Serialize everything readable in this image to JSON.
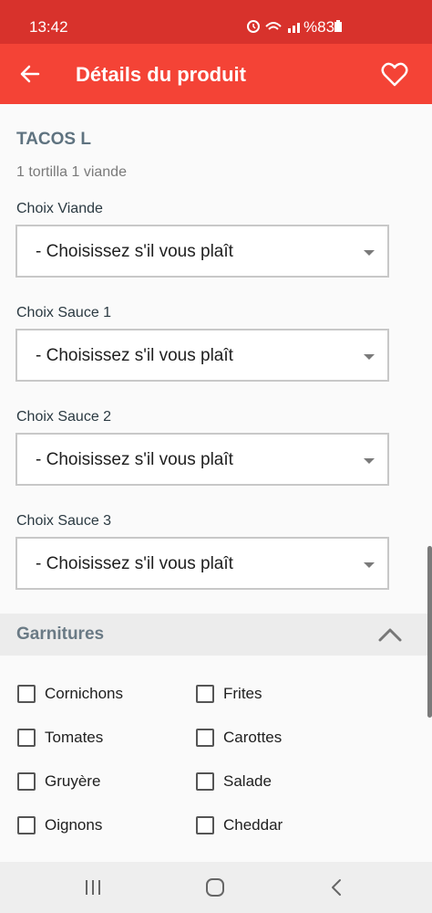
{
  "status": {
    "time": "13:42",
    "battery": "%83"
  },
  "header": {
    "title": "Détails du produit"
  },
  "product": {
    "name": "TACOS L",
    "description": "1 tortilla 1 viande"
  },
  "choices": [
    {
      "label": "Choix Viande",
      "value": "- Choisissez s'il vous plaît"
    },
    {
      "label": "Choix Sauce 1",
      "value": "- Choisissez s'il vous plaît"
    },
    {
      "label": "Choix Sauce 2",
      "value": "- Choisissez s'il vous plaît"
    },
    {
      "label": "Choix Sauce 3",
      "value": "- Choisissez s'il vous plaît"
    }
  ],
  "garnitures": {
    "title": "Garnitures",
    "items": [
      {
        "label": "Cornichons",
        "checked": false
      },
      {
        "label": "Frites",
        "checked": false
      },
      {
        "label": "Tomates",
        "checked": false
      },
      {
        "label": "Carottes",
        "checked": false
      },
      {
        "label": "Gruyère",
        "checked": false
      },
      {
        "label": "Salade",
        "checked": false
      },
      {
        "label": "Oignons",
        "checked": false
      },
      {
        "label": "Cheddar",
        "checked": false
      }
    ]
  },
  "colors": {
    "app_bar": "#f44336",
    "status_bar": "#d8322c"
  }
}
